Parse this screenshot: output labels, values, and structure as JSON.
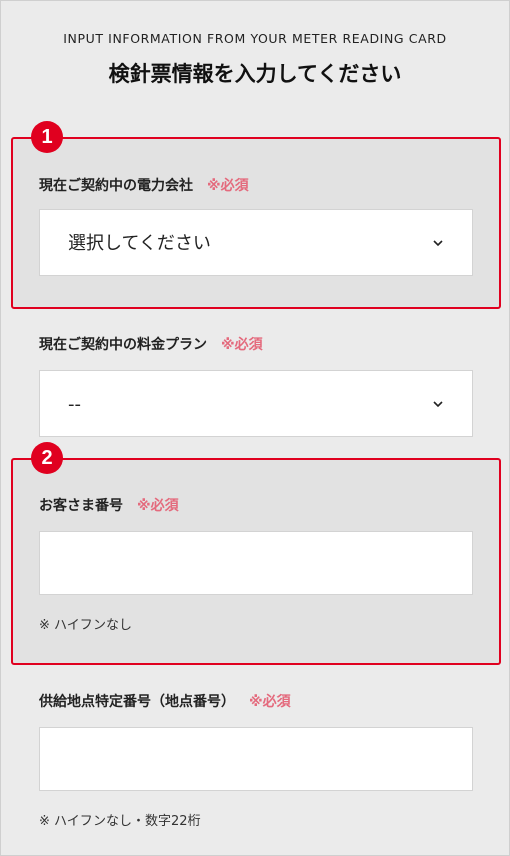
{
  "header": {
    "eyebrow": "INPUT INFORMATION FROM YOUR METER READING CARD",
    "title": "検針票情報を入力してください"
  },
  "badges": [
    "1",
    "2"
  ],
  "fields": {
    "company": {
      "label": "現在ご契約中の電力会社",
      "required": "※必須",
      "value": "選択してください"
    },
    "plan": {
      "label": "現在ご契約中の料金プラン",
      "required": "※必須",
      "value": "--"
    },
    "customer_number": {
      "label": "お客さま番号",
      "required": "※必須",
      "value": "",
      "note": "※ ハイフンなし"
    },
    "supply_point": {
      "label": "供給地点特定番号（地点番号）",
      "required": "※必須",
      "value": "",
      "note": "※ ハイフンなし・数字22桁"
    }
  },
  "colors": {
    "highlight": "#e0001f",
    "required": "#e46a7d",
    "background": "#ebebeb"
  }
}
